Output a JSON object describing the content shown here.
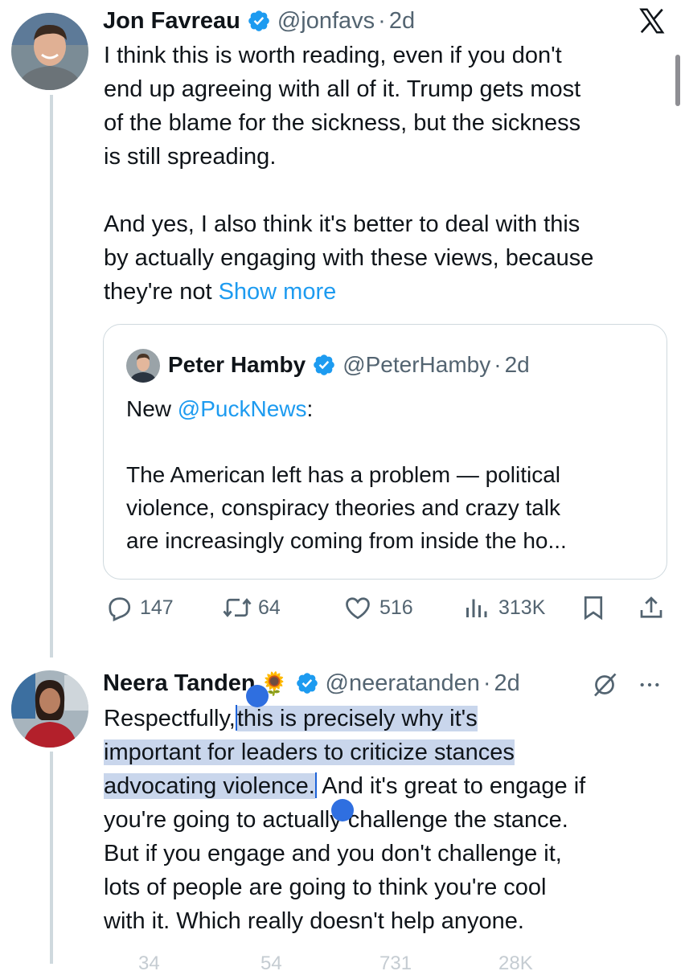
{
  "tweet1": {
    "name": "Jon Favreau",
    "handle": "@jonfavs",
    "sep": "·",
    "time": "2d",
    "text_lines": [
      "I think this is worth reading, even if you don't",
      "end up agreeing with all of it. Trump gets most",
      "of the blame for the sickness, but the sickness",
      "is still spreading.",
      "",
      "And yes, I also think it's better to deal with this",
      "by actually engaging with these views, because"
    ],
    "last_line_prefix": "they're not ",
    "show_more": "Show more",
    "quote": {
      "name": "Peter Hamby",
      "handle": "@PeterHamby",
      "sep": "·",
      "time": "2d",
      "line1_prefix": "New ",
      "mention": "@PuckNews",
      "line1_suffix": ":",
      "text_lines": [
        "The American left has a problem — political",
        "violence, conspiracy theories and crazy talk",
        "are increasingly coming from inside the ho..."
      ]
    },
    "stats": {
      "replies": "147",
      "reposts": "64",
      "likes": "516",
      "views": "313K"
    }
  },
  "tweet2": {
    "name": "Neera Tanden",
    "emoji": "🌻",
    "handle": "@neeratanden",
    "sep": "·",
    "time": "2d",
    "line1_plain": "Respectfully,",
    "line1_selected": "this is precisely why it's",
    "line2_selected": "important for leaders to criticize stances",
    "line3_selected": "advocating violence.",
    "line3_plain": " And it's great to engage if",
    "text_lines": [
      "you're going to actually challenge the stance.",
      "But if you engage and you don't challenge it,",
      "lots of people are going to think you're cool",
      "with it. Which really doesn't help anyone."
    ]
  },
  "footer_stats_faded": [
    "34",
    "54",
    "731",
    "28K"
  ],
  "colors": {
    "accent": "#1d9bf0",
    "muted": "#536471",
    "selection": "#c9d6ec",
    "handle": "#2f6fe0"
  },
  "icons": [
    "verified-badge-icon",
    "x-logo-icon",
    "reply-icon",
    "repost-icon",
    "like-icon",
    "views-icon",
    "bookmark-icon",
    "share-icon",
    "grok-icon",
    "more-icon"
  ]
}
